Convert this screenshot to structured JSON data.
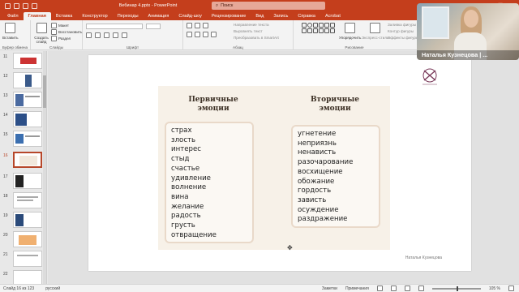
{
  "titlebar": {
    "doc_title": "Вебинар 4.pptx - PowerPoint",
    "search_placeholder": "Поиск",
    "minimize": "—",
    "maximize": "☐",
    "close": "✕"
  },
  "tabs": [
    "Файл",
    "Главная",
    "Вставка",
    "Конструктор",
    "Переходы",
    "Анимация",
    "Слайд-шоу",
    "Рецензирование",
    "Вид",
    "Запись",
    "Справка",
    "Acrobat"
  ],
  "active_tab": "Главная",
  "ribbon": {
    "groups": {
      "clipboard": "Буфер обмена",
      "slides": "Слайды",
      "font": "Шрифт",
      "paragraph": "Абзац",
      "drawing": "Рисование"
    },
    "buttons": {
      "paste": "Вставить",
      "new_slide": "Создать слайд",
      "layout": "Макет",
      "reset": "Восстановить",
      "section": "Раздел",
      "text_direction": "Направление текста",
      "align_text": "Выровнять текст",
      "convert_smartart": "Преобразовать в SmartArt",
      "arrange": "Упорядочить",
      "quick_styles": "Экспресс-стили",
      "shape_fill": "Заливка фигуры",
      "shape_outline": "Контур фигуры",
      "shape_effects": "Эффекты фигуры"
    }
  },
  "thumbnails": [
    {
      "num": "11"
    },
    {
      "num": "12"
    },
    {
      "num": "13"
    },
    {
      "num": "14"
    },
    {
      "num": "15"
    },
    {
      "num": "16",
      "active": true
    },
    {
      "num": "17"
    },
    {
      "num": "18"
    },
    {
      "num": "19"
    },
    {
      "num": "20"
    },
    {
      "num": "21"
    },
    {
      "num": "22"
    }
  ],
  "slide": {
    "primary_heading": "Первичные эмоции",
    "secondary_heading": "Вторичные эмоции",
    "primary_emotions": [
      "страх",
      "злость",
      "интерес",
      "стыд",
      "счастье",
      "удивление",
      "волнение",
      "вина",
      "желание",
      "радость",
      "грусть",
      "отвращение"
    ],
    "secondary_emotions": [
      "угнетение",
      "неприязнь",
      "ненависть",
      "разочарование",
      "восхищение",
      "обожание",
      "гордость",
      "зависть",
      "осуждение",
      "раздражение"
    ],
    "author": "Наталья Кузнецова",
    "panel_color": "#f7f1e8",
    "box_border_color": "#e9d9c9"
  },
  "statusbar": {
    "slide_info": "Слайд 16 из 123",
    "language": "русский",
    "notes": "Заметки",
    "comments": "Примечания",
    "zoom": "105 %"
  },
  "webcam": {
    "name": "Наталья Кузнецова | ..."
  },
  "colors": {
    "accent": "#c43e1c"
  }
}
